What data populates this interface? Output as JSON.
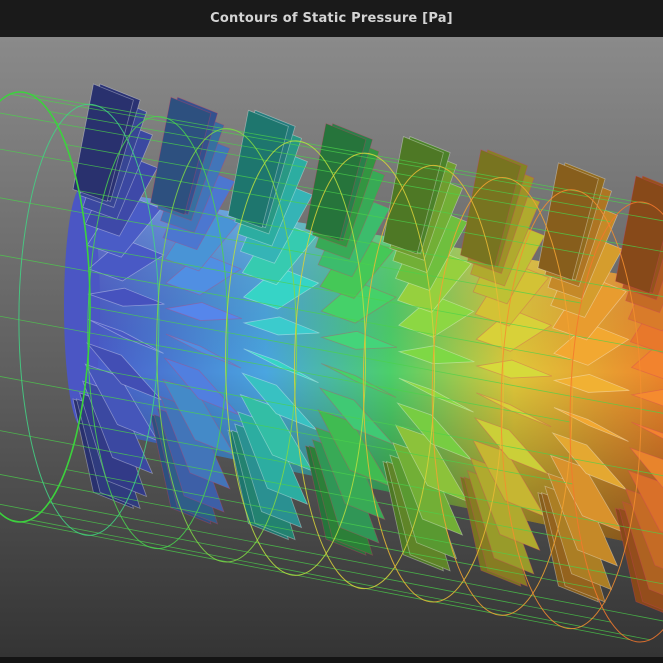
{
  "window": {
    "title": "Contours of Static Pressure [Pa]"
  },
  "colors": {
    "title_bar": "#1a1a1a",
    "title_text": "#d4d4d4",
    "background_top": "#8a8a8a",
    "background_bottom": "#343434",
    "casing_wireframe": "#3cd23c",
    "pressure_colormap": [
      "#3a3aa0",
      "#5a7af0",
      "#37d7c8",
      "#4bd24b",
      "#d2e13c",
      "#f5aa32",
      "#f5782d"
    ]
  },
  "scene": {
    "blade_rows": 8,
    "colormap": "rainbow"
  }
}
